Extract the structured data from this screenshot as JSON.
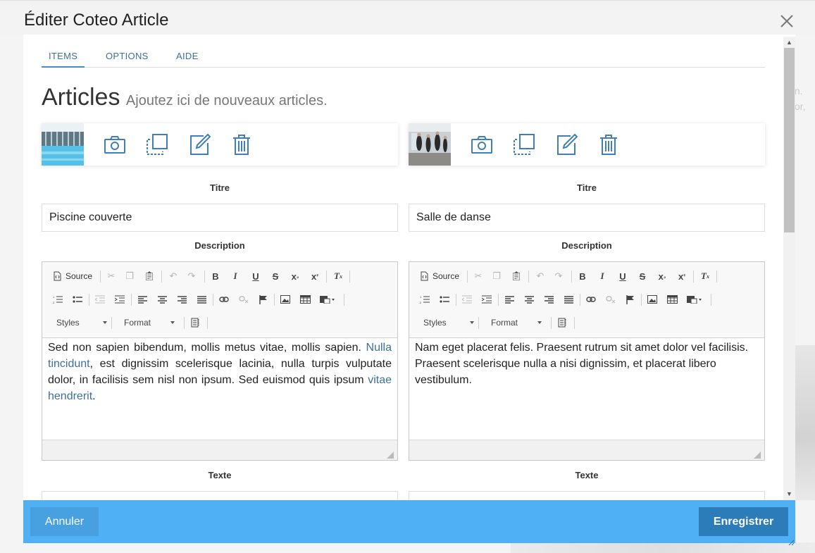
{
  "dialog": {
    "title": "Éditer Coteo Article",
    "close_icon": "close-icon"
  },
  "background": {
    "right_text_line1": "ien.",
    "right_text_line2": "olor,"
  },
  "tabs": [
    {
      "label": "ITEMS",
      "active": true
    },
    {
      "label": "OPTIONS",
      "active": false
    },
    {
      "label": "AIDE",
      "active": false
    }
  ],
  "section": {
    "title": "Articles",
    "subtitle": "Ajoutez ici de nouveaux articles."
  },
  "item_actions": [
    "camera-icon",
    "duplicate-icon",
    "edit-icon",
    "trash-icon"
  ],
  "labels": {
    "titre": "Titre",
    "description": "Description",
    "texte": "Texte"
  },
  "editor_toolbar": {
    "source": "Source",
    "styles": "Styles",
    "format": "Format"
  },
  "articles": [
    {
      "image": "swimming-pool-photo",
      "titre": "Piscine couverte",
      "description_parts": [
        {
          "text": "Sed non sapien bibendum, mollis metus vitae, mollis sapien. ",
          "link": false
        },
        {
          "text": "Nulla tincidunt",
          "link": true
        },
        {
          "text": ", est dignissim scelerisque lacinia, nulla turpis vulputate dolor, in facilisis sem nisl non ipsum. Sed euismod quis ipsum ",
          "link": false
        },
        {
          "text": "vitae hendrerit",
          "link": true
        },
        {
          "text": ".",
          "link": false
        }
      ]
    },
    {
      "image": "dance-studio-photo",
      "titre": "Salle de danse",
      "description_parts": [
        {
          "text": "Nam eget placerat felis. Praesent rutrum sit amet dolor vel facilisis. Praesent scelerisque nulla a nisi dignissim, et placerat libero vestibulum.",
          "link": false
        }
      ]
    }
  ],
  "footer": {
    "cancel": "Annuler",
    "save": "Enregistrer"
  },
  "colors": {
    "footer_bg": "#4fb0f5",
    "save_bg": "#2b7cb9",
    "cancel_bg": "#47a1e0",
    "link": "#3b6fa0",
    "tab_underline": "#3b8ed8"
  }
}
